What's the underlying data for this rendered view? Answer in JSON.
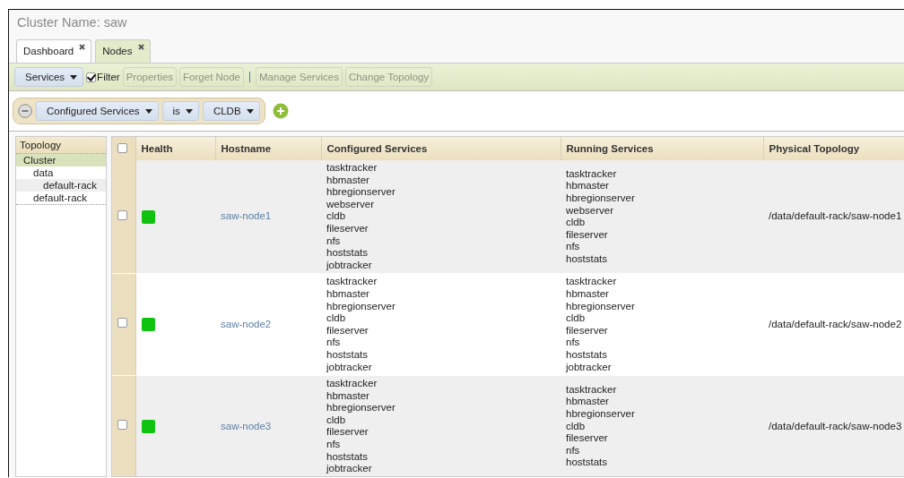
{
  "cluster_name": "Cluster Name: saw",
  "tabs": [
    {
      "label": "Dashboard",
      "selected": false
    },
    {
      "label": "Nodes",
      "selected": true
    }
  ],
  "toolbar": {
    "services_menu": "Services",
    "filter": {
      "label": "Filter",
      "checked": true
    },
    "button_groups": [
      [
        {
          "label": "Properties",
          "disabled": true
        },
        {
          "label": "Forget Node",
          "disabled": true
        }
      ],
      [
        {
          "label": "Manage Services",
          "disabled": true
        },
        {
          "label": "Change Topology",
          "disabled": true
        }
      ]
    ]
  },
  "filter": {
    "field": "Configured Services",
    "operator": "is",
    "value": "CLDB"
  },
  "topology": {
    "title": "Topology",
    "items": [
      {
        "label": "Cluster",
        "selected": true,
        "highlighted": false,
        "children": [
          {
            "label": "data",
            "selected": false,
            "highlighted": false,
            "children": [
              {
                "label": "default-rack",
                "selected": false,
                "highlighted": true
              }
            ]
          },
          {
            "label": "default-rack",
            "selected": false,
            "highlighted": false
          }
        ]
      }
    ]
  },
  "table": {
    "select_all": {
      "checked": false
    },
    "columns": [
      "Health",
      "Hostname",
      "Configured Services",
      "Running Services",
      "Physical Topology"
    ],
    "rows": [
      {
        "checked": false,
        "healthy": true,
        "hostname": "saw-node1",
        "configured_services": [
          "tasktracker",
          "hbmaster",
          "hbregionserver",
          "webserver",
          "cldb",
          "fileserver",
          "nfs",
          "hoststats",
          "jobtracker"
        ],
        "running_services": [
          "tasktracker",
          "hbmaster",
          "hbregionserver",
          "webserver",
          "cldb",
          "fileserver",
          "nfs",
          "hoststats"
        ],
        "physical_topology": "/data/default-rack/saw-node1"
      },
      {
        "checked": false,
        "healthy": true,
        "hostname": "saw-node2",
        "configured_services": [
          "tasktracker",
          "hbmaster",
          "hbregionserver",
          "cldb",
          "fileserver",
          "nfs",
          "hoststats",
          "jobtracker"
        ],
        "running_services": [
          "tasktracker",
          "hbmaster",
          "hbregionserver",
          "cldb",
          "fileserver",
          "nfs",
          "hoststats",
          "jobtracker"
        ],
        "physical_topology": "/data/default-rack/saw-node2"
      },
      {
        "checked": false,
        "healthy": true,
        "hostname": "saw-node3",
        "configured_services": [
          "tasktracker",
          "hbmaster",
          "hbregionserver",
          "cldb",
          "fileserver",
          "nfs",
          "hoststats",
          "jobtracker"
        ],
        "running_services": [
          "tasktracker",
          "hbmaster",
          "hbregionserver",
          "cldb",
          "fileserver",
          "nfs",
          "hoststats"
        ],
        "physical_topology": "/data/default-rack/saw-node3"
      }
    ]
  }
}
